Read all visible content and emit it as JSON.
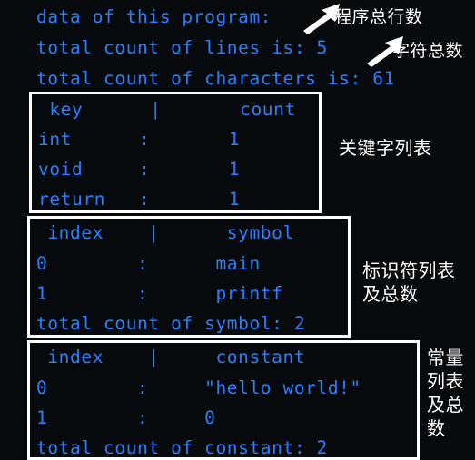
{
  "terminal": {
    "background_color": "#070a0d",
    "text_color": "#2b7fff",
    "annotation_color": "#ffffff",
    "header_lines": [
      "data of this program:",
      "total count of lines is: 5",
      "total count of characters is: 61"
    ],
    "summary": {
      "total_lines": "5",
      "total_characters": "61",
      "total_symbol": "2",
      "total_constant": "2"
    }
  },
  "keyword_table": {
    "header": " key      |       count",
    "rows": [
      "int      :       1",
      "void     :       1",
      "return   :       1"
    ],
    "entries": [
      {
        "key": "int",
        "count": "1"
      },
      {
        "key": "void",
        "count": "1"
      },
      {
        "key": "return",
        "count": "1"
      }
    ],
    "columns": [
      "key",
      "count"
    ]
  },
  "symbol_table": {
    "header": " index    |      symbol",
    "rows": [
      "0        :      main",
      "1        :      printf",
      "total count of symbol: 2"
    ],
    "entries": [
      {
        "index": "0",
        "symbol": "main"
      },
      {
        "index": "1",
        "symbol": "printf"
      }
    ],
    "columns": [
      "index",
      "symbol"
    ],
    "total_line": "total count of symbol: 2"
  },
  "constant_table": {
    "header": " index    |     constant",
    "rows": [
      "0        :     \"hello world!\"",
      "1        :     0",
      "total count of constant: 2"
    ],
    "entries": [
      {
        "index": "0",
        "constant": "\"hello world!\""
      },
      {
        "index": "1",
        "constant": "0"
      }
    ],
    "columns": [
      "index",
      "constant"
    ],
    "total_line": "total count of constant: 2"
  },
  "annotations": {
    "total_lines_label": "程序总行数",
    "total_chars_label": "字符总数",
    "keyword_list_label": "关键字列表",
    "symbol_list_label": "标识符列表\n及总数",
    "constant_list_label": "常量\n列表\n及总\n数"
  }
}
